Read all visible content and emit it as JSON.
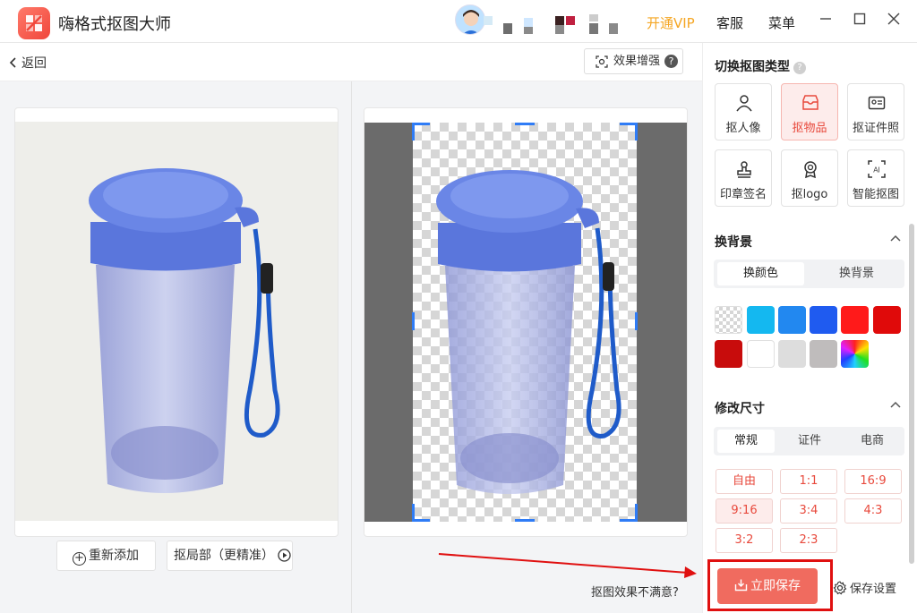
{
  "app": {
    "title": "嗨格式抠图大师"
  },
  "header": {
    "vip_label": "开通VIP",
    "service_label": "客服",
    "menu_label": "菜单",
    "minimize_icon": "minimize-icon",
    "maximize_icon": "maximize-icon",
    "close_icon": "close-icon"
  },
  "toolbar": {
    "back_label": "返回",
    "enhance_label": "效果增强",
    "enhance_help": "?"
  },
  "left": {
    "readd_label": "重新添加",
    "local_cut_label": "抠局部（更精准）"
  },
  "right": {
    "unsatisfied_label": "抠图效果不满意?"
  },
  "panel": {
    "switch_type_title": "切换抠图类型",
    "help": "?",
    "types": [
      {
        "label": "抠人像",
        "icon": "person-icon",
        "active": false
      },
      {
        "label": "抠物品",
        "icon": "box-icon",
        "active": true
      },
      {
        "label": "抠证件照",
        "icon": "id-card-icon",
        "active": false
      },
      {
        "label": "印章签名",
        "icon": "stamp-icon",
        "active": false
      },
      {
        "label": "抠logo",
        "icon": "badge-icon",
        "active": false
      },
      {
        "label": "智能抠图",
        "icon": "ai-scan-icon",
        "active": false
      }
    ],
    "bg_title": "换背景",
    "bg_tabs": [
      "换颜色",
      "换背景"
    ],
    "bg_tab_selected": "换颜色",
    "colors": [
      "transparent",
      "#14b8f0",
      "#2288f0",
      "#1f5bf0",
      "#ff1a1a",
      "#e00a0a",
      "#c80c0c",
      "#ffffff",
      "#dddddd",
      "#bfbcbc",
      "gradient"
    ],
    "size_title": "修改尺寸",
    "size_tabs": [
      "常规",
      "证件",
      "电商"
    ],
    "size_tab_selected": "常规",
    "ratios": [
      "自由",
      "1:1",
      "16:9",
      "9:16",
      "3:4",
      "4:3",
      "3:2",
      "2:3"
    ],
    "ratio_selected": "9:16",
    "save_label": "立即保存",
    "save_settings_label": "保存设置"
  }
}
